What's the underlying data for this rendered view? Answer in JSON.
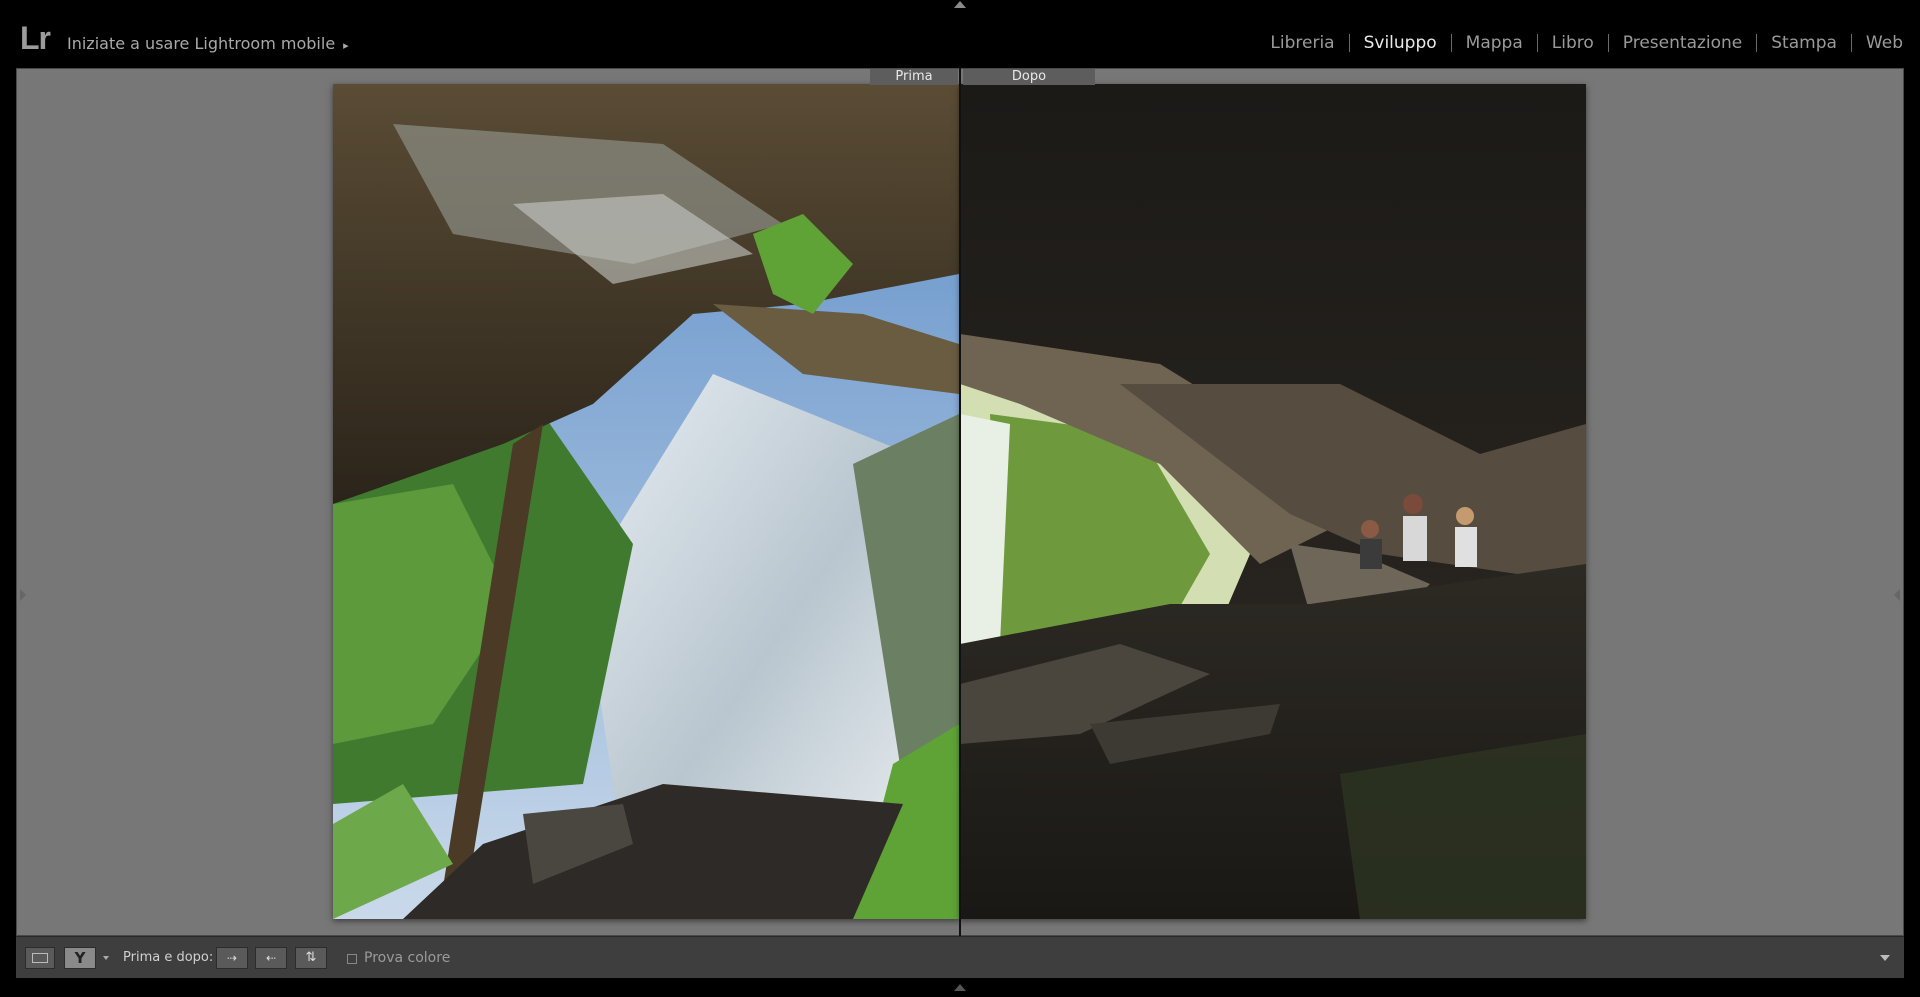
{
  "app": {
    "logo": "Lr",
    "identity_plate": "Iniziate a usare Lightroom mobile",
    "identity_arrow": "▸"
  },
  "modules": [
    {
      "label": "Libreria",
      "active": false
    },
    {
      "label": "Sviluppo",
      "active": true
    },
    {
      "label": "Mappa",
      "active": false
    },
    {
      "label": "Libro",
      "active": false
    },
    {
      "label": "Presentazione",
      "active": false
    },
    {
      "label": "Stampa",
      "active": false
    },
    {
      "label": "Web",
      "active": false
    }
  ],
  "view": {
    "before_label": "Prima",
    "after_label": "Dopo"
  },
  "toolbar": {
    "before_after_label": "Prima e dopo:",
    "before_after_icon": "Y",
    "copy_right_glyph": "⇢",
    "copy_left_glyph": "⇠",
    "swap_glyph": "⇅",
    "soft_proof_label": "Prova colore",
    "soft_proof_checked": false
  },
  "colors": {
    "active_module": "#eaeaea",
    "inactive_module": "#9a9a9a",
    "canvas_bg": "#777777",
    "toolbar_bg": "#3e3e3e"
  }
}
